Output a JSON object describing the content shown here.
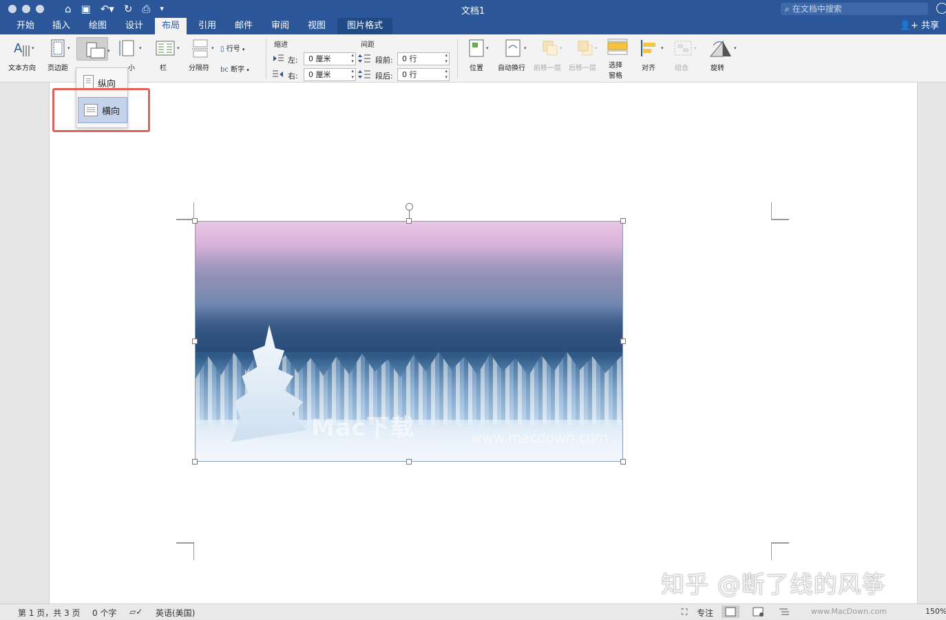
{
  "window": {
    "title": "文档1",
    "search_placeholder": "在文档中搜索",
    "share_label": "共享"
  },
  "tabs": [
    {
      "label": "开始"
    },
    {
      "label": "插入"
    },
    {
      "label": "绘图"
    },
    {
      "label": "设计"
    },
    {
      "label": "布局"
    },
    {
      "label": "引用"
    },
    {
      "label": "邮件"
    },
    {
      "label": "审阅"
    },
    {
      "label": "视图"
    },
    {
      "label": "图片格式"
    }
  ],
  "active_tab": "布局",
  "ribbon": {
    "text_direction": "文本方向",
    "margins": "页边距",
    "size_partial": "小",
    "columns": "栏",
    "breaks": "分隔符",
    "line_numbers": "行号",
    "hyphenation": "断字",
    "indent_group": "缩进",
    "spacing_group": "间距",
    "left_label": "左:",
    "right_label": "右:",
    "left_value": "0 厘米",
    "right_value": "0 厘米",
    "before_label": "段前:",
    "after_label": "段后:",
    "before_value": "0 行",
    "after_value": "0 行",
    "position": "位置",
    "wrap_text": "自动换行",
    "bring_forward": "前移一层",
    "send_backward": "后移一层",
    "selection_pane_line1": "选择",
    "selection_pane_line2": "窗格",
    "align": "对齐",
    "group": "组合",
    "rotate": "旋转"
  },
  "orientation_menu": {
    "portrait": "纵向",
    "landscape": "横向",
    "selected": "横向"
  },
  "image": {
    "watermark": "Mac下载",
    "watermark_url": "www.macdown.com"
  },
  "overlay_watermark": "知乎 @断了线的风筝",
  "status": {
    "page": "第 1 页，共 3 页",
    "words": "0 个字",
    "language": "英语(美国)",
    "focus": "专注",
    "zoom": "150%",
    "footer_watermark": "www.MacDown.com"
  },
  "colors": {
    "title_bar": "#2b579a",
    "ribbon_bg": "#f3f3f3",
    "highlight_box": "#e0605a",
    "selected_item": "#c5d4ea"
  }
}
